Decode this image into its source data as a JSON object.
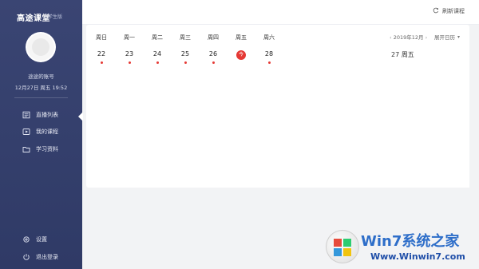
{
  "sidebar": {
    "logo": "高途课堂",
    "role_tag": "学生版",
    "username": "途途的账号",
    "datetime": "12月27日 周五 19:52",
    "nav": [
      {
        "label": "直播列表",
        "icon": "live-list-icon"
      },
      {
        "label": "我的课程",
        "icon": "course-icon"
      },
      {
        "label": "学习资料",
        "icon": "folder-icon"
      }
    ],
    "bottom": [
      {
        "label": "设置",
        "icon": "gear-icon"
      },
      {
        "label": "退出登录",
        "icon": "power-icon"
      }
    ]
  },
  "header": {
    "refresh_label": "刷新课程"
  },
  "calendar": {
    "days": [
      {
        "weekday": "周日",
        "date": "22",
        "has_dot": true
      },
      {
        "weekday": "周一",
        "date": "23",
        "has_dot": true
      },
      {
        "weekday": "周二",
        "date": "24",
        "has_dot": true
      },
      {
        "weekday": "周三",
        "date": "25",
        "has_dot": true
      },
      {
        "weekday": "周四",
        "date": "26",
        "has_dot": true
      },
      {
        "weekday": "周五",
        "date": "今",
        "is_today": true,
        "has_dot": false
      },
      {
        "weekday": "周六",
        "date": "28",
        "has_dot": true
      }
    ],
    "month_label": "2019年12月",
    "expand_label": "展开日历",
    "selected_date": "27 周五"
  },
  "watermark": {
    "logo_text": "Win7系统之家",
    "url": "Www.Winwin7.com"
  },
  "colors": {
    "sidebar": "#36416f",
    "accent": "#e53935",
    "brand_blue": "#2e6ec9"
  }
}
